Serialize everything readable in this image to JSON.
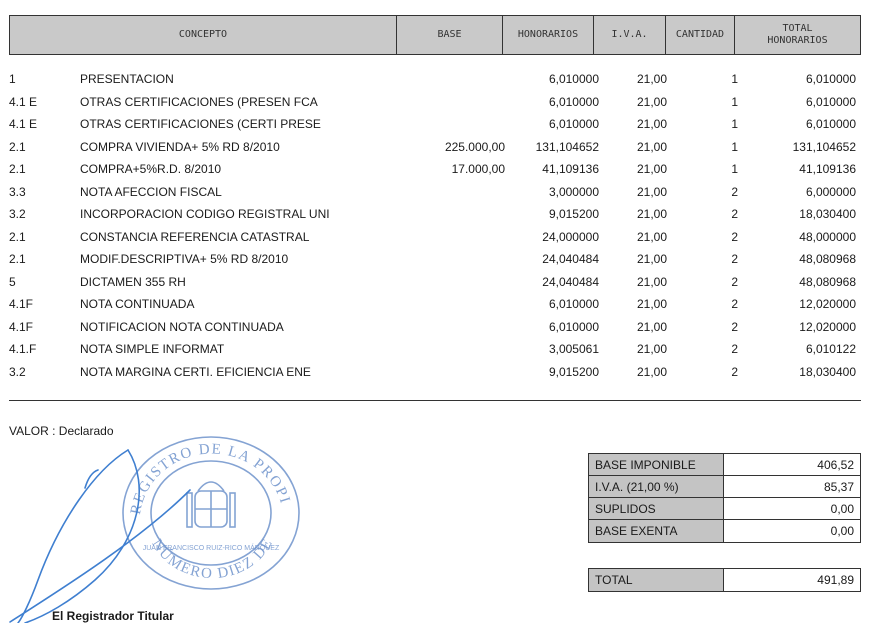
{
  "header": {
    "concepto": "CONCEPTO",
    "base": "BASE",
    "honorarios": "HONORARIOS",
    "iva": "I.V.A.",
    "cantidad": "CANTIDAD",
    "total_line1": "TOTAL",
    "total_line2": "HONORARIOS"
  },
  "rows": [
    {
      "code": "1",
      "concept": "PRESENTACION",
      "base": "",
      "honorarios": "6,010000",
      "iva": "21,00",
      "cantidad": "1",
      "total": "6,010000"
    },
    {
      "code": "4.1 E",
      "concept": "OTRAS CERTIFICACIONES (PRESEN FCA",
      "base": "",
      "honorarios": "6,010000",
      "iva": "21,00",
      "cantidad": "1",
      "total": "6,010000"
    },
    {
      "code": "4.1 E",
      "concept": "OTRAS CERTIFICACIONES (CERTI PRESE",
      "base": "",
      "honorarios": "6,010000",
      "iva": "21,00",
      "cantidad": "1",
      "total": "6,010000"
    },
    {
      "code": "2.1",
      "concept": "COMPRA VIVIENDA+ 5% RD 8/2010",
      "base": "225.000,00",
      "honorarios": "131,104652",
      "iva": "21,00",
      "cantidad": "1",
      "total": "131,104652"
    },
    {
      "code": "2.1",
      "concept": "COMPRA+5%R.D. 8/2010",
      "base": "17.000,00",
      "honorarios": "41,109136",
      "iva": "21,00",
      "cantidad": "1",
      "total": "41,109136"
    },
    {
      "code": "3.3",
      "concept": "NOTA AFECCION FISCAL",
      "base": "",
      "honorarios": "3,000000",
      "iva": "21,00",
      "cantidad": "2",
      "total": "6,000000"
    },
    {
      "code": "3.2",
      "concept": "INCORPORACION CODIGO REGISTRAL UNI",
      "base": "",
      "honorarios": "9,015200",
      "iva": "21,00",
      "cantidad": "2",
      "total": "18,030400"
    },
    {
      "code": "2.1",
      "concept": "CONSTANCIA REFERENCIA CATASTRAL",
      "base": "",
      "honorarios": "24,000000",
      "iva": "21,00",
      "cantidad": "2",
      "total": "48,000000"
    },
    {
      "code": "2.1",
      "concept": "MODIF.DESCRIPTIVA+ 5% RD 8/2010",
      "base": "",
      "honorarios": "24,040484",
      "iva": "21,00",
      "cantidad": "2",
      "total": "48,080968"
    },
    {
      "code": "5",
      "concept": "DICTAMEN 355 RH",
      "base": "",
      "honorarios": "24,040484",
      "iva": "21,00",
      "cantidad": "2",
      "total": "48,080968"
    },
    {
      "code": "4.1F",
      "concept": "NOTA CONTINUADA",
      "base": "",
      "honorarios": "6,010000",
      "iva": "21,00",
      "cantidad": "2",
      "total": "12,020000"
    },
    {
      "code": "4.1F",
      "concept": "NOTIFICACION  NOTA CONTINUADA",
      "base": "",
      "honorarios": "6,010000",
      "iva": "21,00",
      "cantidad": "2",
      "total": "12,020000"
    },
    {
      "code": "4.1.F",
      "concept": "NOTA SIMPLE INFORMAT",
      "base": "",
      "honorarios": "3,005061",
      "iva": "21,00",
      "cantidad": "2",
      "total": "6,010122"
    },
    {
      "code": "3.2",
      "concept": "NOTA MARGINA CERTI. EFICIENCIA ENE",
      "base": "",
      "honorarios": "9,015200",
      "iva": "21,00",
      "cantidad": "2",
      "total": "18,030400"
    }
  ],
  "valor": "VALOR : Declarado",
  "summary": [
    {
      "label": "BASE IMPONIBLE",
      "value": "406,52"
    },
    {
      "label": "I.V.A. (21,00 %)",
      "value": "85,37"
    },
    {
      "label": "SUPLIDOS",
      "value": "0,00"
    },
    {
      "label": "BASE EXENTA",
      "value": "0,00"
    }
  ],
  "total": {
    "label": "TOTAL",
    "value": "491,89"
  },
  "stamp": {
    "outer_text": "REGISTRO DE LA PROPIEDAD",
    "inner_text": "JUAN FRANCISCO RUIZ-RICO MÁRQUEZ",
    "bottom_text": "NÚMERO DIEZ DE MÁLAGA",
    "color": "#6f93cc"
  },
  "signature_color": "#3f7fd0",
  "signer": "El Registrador Titular"
}
